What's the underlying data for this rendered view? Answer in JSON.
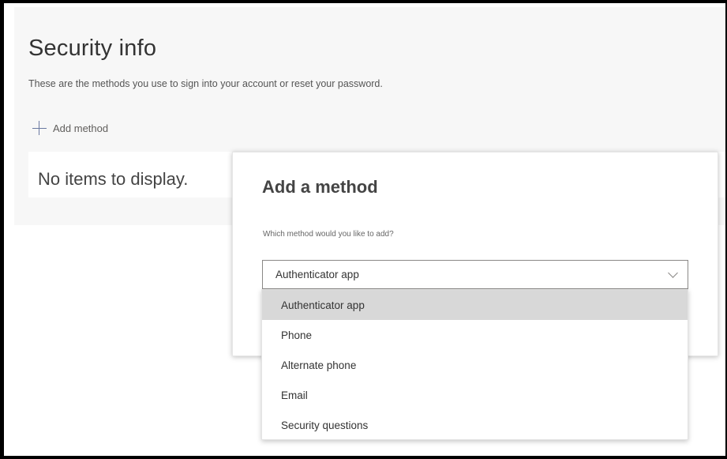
{
  "page": {
    "title": "Security info",
    "subtitle": "These are the methods you use to sign into your account or reset your password.",
    "add_method_label": "Add method",
    "empty_message": "No items to display."
  },
  "dialog": {
    "title": "Add a method",
    "question": "Which method would you like to add?",
    "selected_value": "Authenticator app",
    "options": [
      {
        "label": "Authenticator app",
        "selected": true
      },
      {
        "label": "Phone",
        "selected": false
      },
      {
        "label": "Alternate phone",
        "selected": false
      },
      {
        "label": "Email",
        "selected": false
      },
      {
        "label": "Security questions",
        "selected": false
      }
    ]
  },
  "icons": {
    "add": "plus-icon",
    "dropdown": "chevron-down-icon"
  },
  "colors": {
    "page_background": "#f7f7f7",
    "plus_icon": "#6b7aa1",
    "option_highlight": "#d8d8d8",
    "frame_border": "#000000"
  }
}
